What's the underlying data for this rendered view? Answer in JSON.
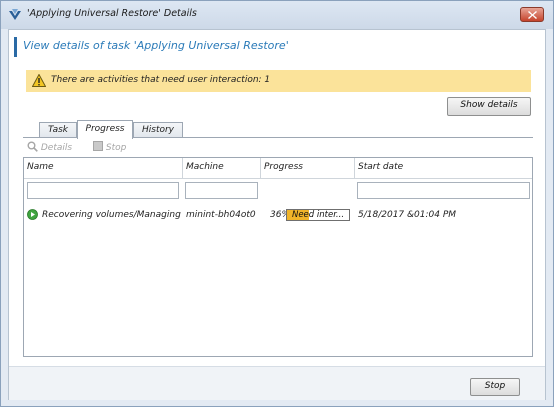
{
  "window": {
    "title": "'Applying Universal Restore' Details"
  },
  "header": {
    "title": "View details of task 'Applying Universal Restore'"
  },
  "notice": {
    "text": "There are activities that need user interaction: 1"
  },
  "buttons": {
    "show_details": "Show details",
    "stop": "Stop"
  },
  "tabs": [
    {
      "label": "Task"
    },
    {
      "label": "Progress",
      "active": true
    },
    {
      "label": "History"
    }
  ],
  "toolbar": {
    "details": "Details",
    "stop": "Stop"
  },
  "grid": {
    "columns": [
      "Name",
      "Machine",
      "Progress",
      "Start date"
    ],
    "rows": [
      {
        "status_icon": "running-icon",
        "name": "Recovering volumes/Managing ...",
        "machine": "minint-bh04ot0",
        "progress_pct": "36%",
        "progress_fraction": 0.36,
        "progress_label": "Need inter...",
        "start_date": "5/18/2017 &01:04 PM"
      }
    ]
  },
  "colors": {
    "accent": "#2a7ab8",
    "notice_bg": "#fbe39a",
    "progress_fill": "#f0b429",
    "running_icon": "#3fa43f"
  }
}
